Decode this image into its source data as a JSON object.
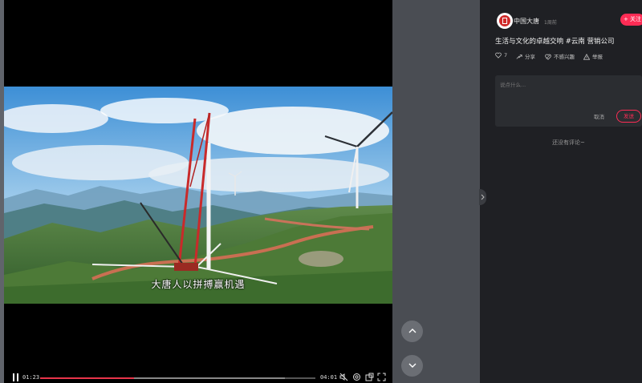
{
  "video": {
    "subtitle": "大唐人以拼搏赢机遇",
    "current_time": "01:23",
    "duration": "04:01",
    "progress_fraction": 0.34,
    "buffered_fraction": 0.89
  },
  "post": {
    "author": "中国大唐",
    "time_ago": "1周前",
    "follow_label": "+ 关注",
    "title": "生活与文化的卓越交响 #云南 营销公司",
    "like_count": "7",
    "share_label": "分享",
    "not_interested_label": "不感兴趣",
    "report_label": "举报"
  },
  "comments": {
    "placeholder": "说点什么...",
    "cancel_label": "取消",
    "send_label": "发送",
    "empty_text": "还没有评论~"
  },
  "colors": {
    "accent": "#fe2c55",
    "progress": "#e8344a",
    "panel_bg": "#1f2024"
  },
  "icons": [
    "pause-icon",
    "mute-icon",
    "settings-icon",
    "pip-icon",
    "fullscreen-icon",
    "heart-icon",
    "share-icon",
    "not-interested-icon",
    "report-icon",
    "chevron-up-icon",
    "chevron-down-icon",
    "chevron-right-icon"
  ]
}
